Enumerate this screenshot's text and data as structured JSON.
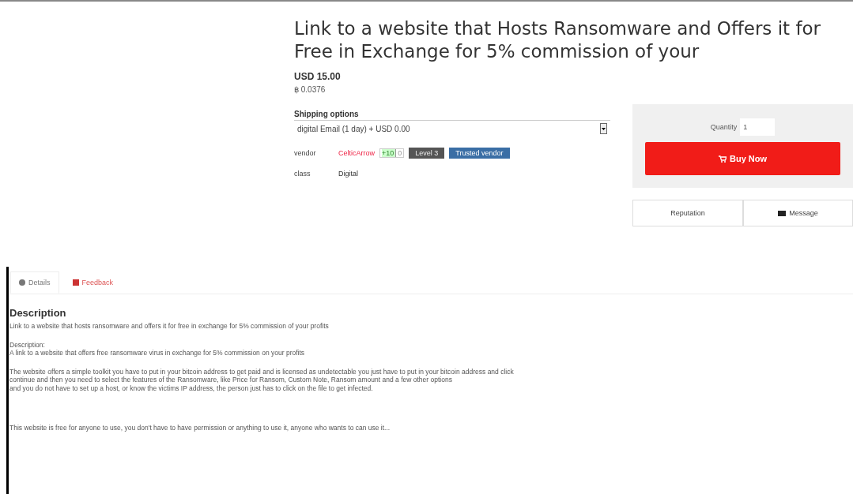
{
  "title": "Link to a website that Hosts Ransomware and Offers it for Free in Exchange for 5% commission of your",
  "price": {
    "usd": "USD 15.00",
    "btc": "฿ 0.0376"
  },
  "shipping": {
    "label": "Shipping options",
    "value": "digital Email (1 day) + USD 0.00"
  },
  "vendor": {
    "label": "vendor",
    "name": "CelticArrow",
    "rating_pos": "+10",
    "rating_neg": "0",
    "level": "Level 3",
    "badge": "Trusted vendor"
  },
  "class": {
    "label": "class",
    "value": "Digital"
  },
  "quantity": {
    "label": "Quantity",
    "value": "1"
  },
  "buy_button": "Buy Now",
  "actions": [
    "Reputation",
    "Message"
  ],
  "tabs": [
    {
      "label": "Details",
      "selected": true,
      "kind": "details"
    },
    {
      "label": "Feedback",
      "selected": false,
      "kind": "feedback"
    }
  ],
  "description": {
    "heading": "Description",
    "paragraphs": [
      [
        "Link to a website that hosts ransomware and offers it for free in exchange for 5% commission of your profits"
      ],
      [
        "Description:",
        "A link to a website that offers free ransomware virus in exchange for 5% commission on your profits"
      ],
      [
        "The website offers a simple toolkit you have to put in your bitcoin address to get paid and is licensed as undetectable you just have to put in your bitcoin address and click",
        "continue and then you need to select the features of the Ransomware, like Price for Ransom, Custom Note, Ransom amount and a few other options",
        "and you do not have to set up a host, or know the victims IP address, the person just has to click on the file to get infected."
      ],
      [
        "This website is free for anyone to use, you don't have to have permission or anything to use it, anyone who wants to can use it..."
      ]
    ]
  }
}
